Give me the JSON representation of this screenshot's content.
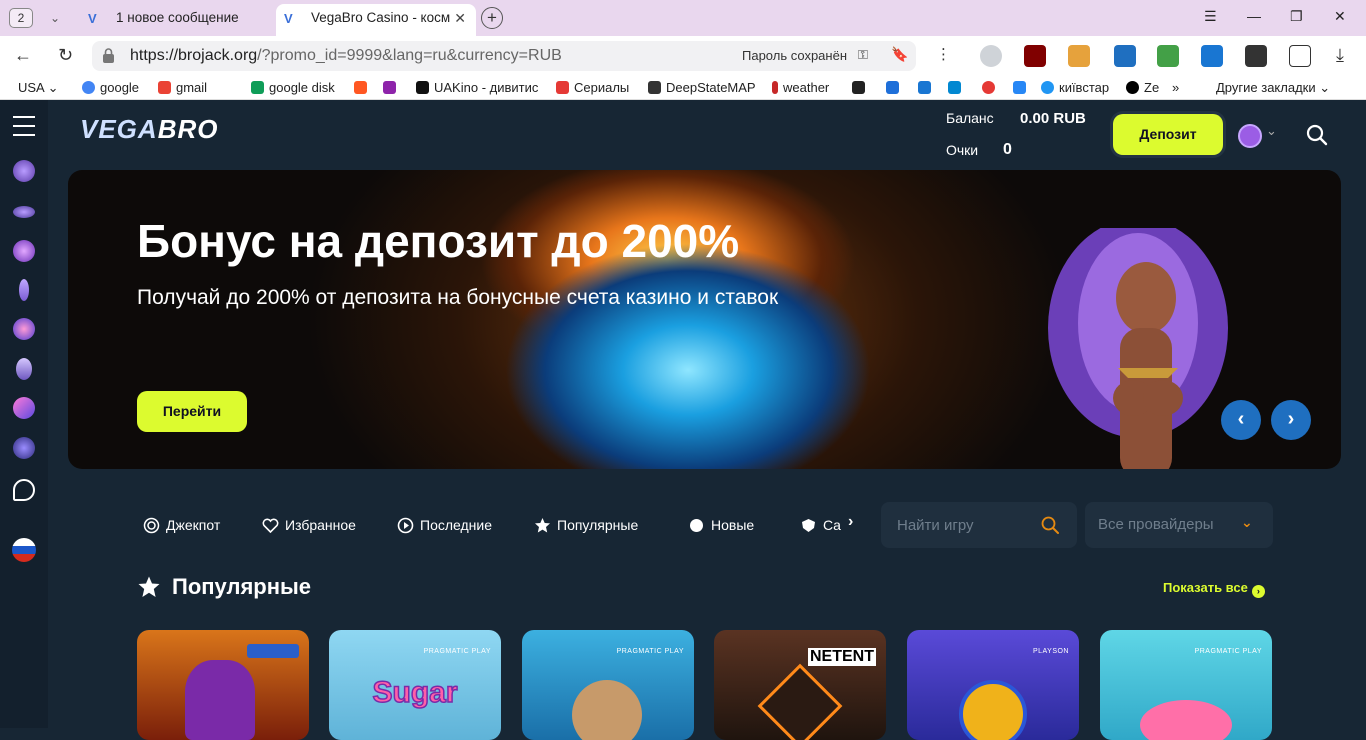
{
  "browser": {
    "tab_count": "2",
    "tabs": [
      {
        "label": "1 новое сообщение"
      },
      {
        "label": "VegaBro Casino - космі"
      }
    ],
    "url_host": "https://brojack.org",
    "url_path": "/?promo_id=9999&lang=ru&currency=RUB",
    "password_saved": "Пароль сохранён",
    "bookmarks": [
      {
        "label": "USA",
        "color": "#ffffff"
      },
      {
        "label": "google",
        "color": "#4285f4"
      },
      {
        "label": "gmail",
        "color": "#ea4335"
      },
      {
        "label": "google disk",
        "color": "#0f9d58"
      },
      {
        "label": "",
        "color": "#ff5722"
      },
      {
        "label": "",
        "color": "#8e24aa"
      },
      {
        "label": "UAKino - дивитис",
        "color": "#111111"
      },
      {
        "label": "Сериалы",
        "color": "#e53935"
      },
      {
        "label": "DeepStateMAP",
        "color": "#333333"
      },
      {
        "label": "weather",
        "color": "#c62828"
      },
      {
        "label": "",
        "color": "#222222"
      },
      {
        "label": "",
        "color": "#1e6fd9"
      },
      {
        "label": "",
        "color": "#1976d2"
      },
      {
        "label": "",
        "color": "#0288d1"
      },
      {
        "label": "",
        "color": "#e53935"
      },
      {
        "label": "",
        "color": "#2787f5"
      },
      {
        "label": "київстар",
        "color": "#2196f3"
      },
      {
        "label": "Ze",
        "color": "#000000"
      }
    ],
    "other_bookmarks": "Другие закладки"
  },
  "site": {
    "logo_a": "VEGA",
    "logo_b": "BRO",
    "balance_label": "Баланс",
    "balance_value": "0.00 RUB",
    "points_label": "Очки",
    "points_value": "0",
    "deposit_button": "Депозит"
  },
  "banner": {
    "title": "Бонус на депозит до 200%",
    "subtitle": "Получай до 200% от депозита на бонусные счета казино и ставок",
    "cta": "Перейти"
  },
  "categories": [
    {
      "label": "Джекпот",
      "icon": "jackpot-icon"
    },
    {
      "label": "Избранное",
      "icon": "heart-icon"
    },
    {
      "label": "Последние",
      "icon": "recent-icon"
    },
    {
      "label": "Популярные",
      "icon": "star-icon"
    },
    {
      "label": "Новые",
      "icon": "new-icon"
    },
    {
      "label": "Ca",
      "icon": "shield-icon"
    }
  ],
  "search": {
    "placeholder": "Найти игру"
  },
  "providers": {
    "label": "Все провайдеры"
  },
  "popular": {
    "title": "Популярные",
    "show_all": "Показать все",
    "games": [
      {
        "provider": "",
        "name": "",
        "bg": "#c45a10"
      },
      {
        "provider": "PRAGMATIC PLAY",
        "name": "Sugar",
        "bg": "#6fc6e8"
      },
      {
        "provider": "PRAGMATIC PLAY",
        "name": "",
        "bg": "#2c9bd0"
      },
      {
        "provider": "NETENT",
        "name": "",
        "bg": "#3a2218"
      },
      {
        "provider": "PLAYSON",
        "name": "",
        "bg": "#3d3ab0"
      },
      {
        "provider": "PRAGMATIC PLAY",
        "name": "",
        "bg": "#49c7d9"
      }
    ]
  }
}
